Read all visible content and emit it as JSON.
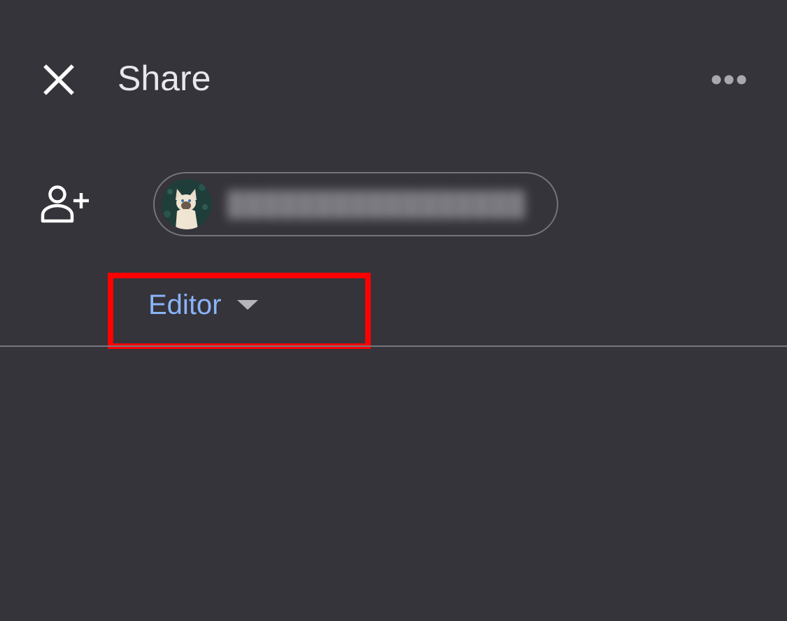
{
  "header": {
    "close_icon": "close-icon",
    "title": "Share",
    "more_icon": "more-horiz-icon"
  },
  "recipients": {
    "add_icon": "person-add-icon",
    "chip": {
      "avatar": "cat-avatar",
      "email_text": "█████████████████",
      "blurred": true
    }
  },
  "role": {
    "label": "Editor",
    "caret_icon": "caret-down-icon"
  },
  "annotation": {
    "highlight_color": "#ff0000"
  },
  "colors": {
    "background": "#35343a",
    "accent": "#8ab4f8",
    "text": "#e8e7ec",
    "divider": "#77767e"
  }
}
